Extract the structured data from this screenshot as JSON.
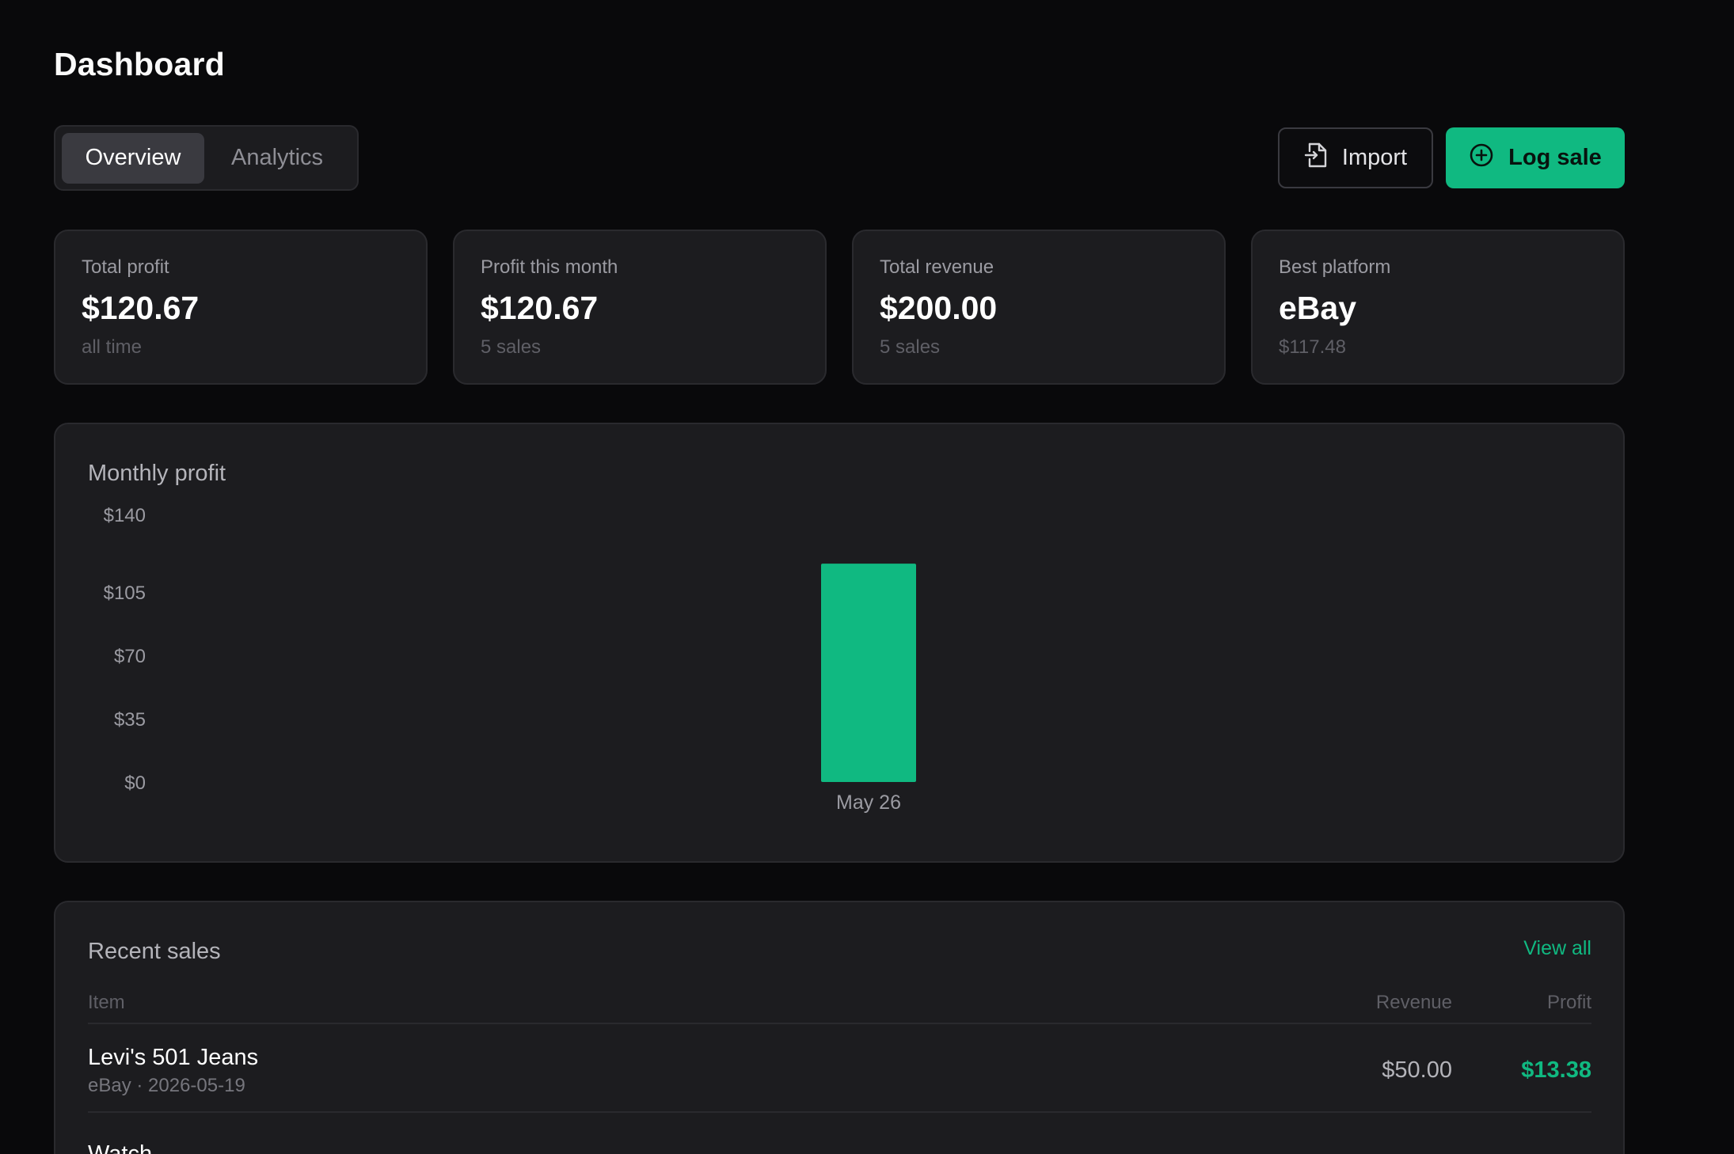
{
  "page": {
    "title": "Dashboard"
  },
  "tabs": [
    {
      "label": "Overview",
      "active": true
    },
    {
      "label": "Analytics",
      "active": false
    }
  ],
  "actions": {
    "import_label": "Import",
    "import_icon": "file-import-icon",
    "log_sale_label": "Log sale",
    "log_sale_icon": "plus-circle-icon"
  },
  "stats": [
    {
      "label": "Total profit",
      "value": "$120.67",
      "sub": "all time"
    },
    {
      "label": "Profit this month",
      "value": "$120.67",
      "sub": "5 sales"
    },
    {
      "label": "Total revenue",
      "value": "$200.00",
      "sub": "5 sales"
    },
    {
      "label": "Best platform",
      "value": "eBay",
      "sub": "$117.48"
    }
  ],
  "monthly_profit": {
    "title": "Monthly profit"
  },
  "chart_data": {
    "type": "bar",
    "title": "Monthly profit",
    "categories": [
      "May 26"
    ],
    "values": [
      120.67
    ],
    "ylim": [
      0,
      140
    ],
    "y_ticks": [
      "$140",
      "$105",
      "$70",
      "$35",
      "$0"
    ],
    "y_tick_values": [
      140,
      105,
      70,
      35,
      0
    ],
    "grid": false,
    "bar_color": "#10b981"
  },
  "recent_sales": {
    "title": "Recent sales",
    "view_all_label": "View all",
    "columns": {
      "item": "Item",
      "revenue": "Revenue",
      "profit": "Profit"
    },
    "rows": [
      {
        "name": "Levi's 501 Jeans",
        "meta": "eBay · 2026-05-19",
        "revenue": "$50.00",
        "profit": "$13.38"
      },
      {
        "name": "Watch",
        "meta": "",
        "revenue": "",
        "profit": ""
      }
    ]
  },
  "colors": {
    "accent": "#10b981",
    "background": "#09090b",
    "card": "#1c1c1f"
  }
}
